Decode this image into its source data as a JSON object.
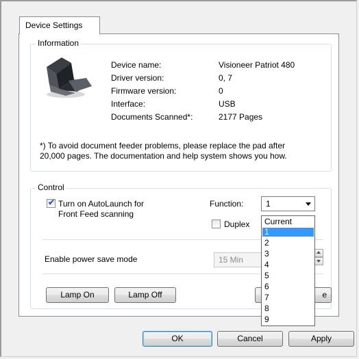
{
  "tab_label": "Device Settings",
  "information": {
    "group_label": "Information",
    "rows": [
      {
        "label": "Device name:",
        "value": "Visioneer Patriot 480"
      },
      {
        "label": "Driver version:",
        "value": "0, 7"
      },
      {
        "label": "Firmware version:",
        "value": "0"
      },
      {
        "label": "Interface:",
        "value": "USB"
      },
      {
        "label": "Documents Scanned*:",
        "value": "2177 Pages"
      }
    ],
    "note_line1": "*) To avoid document feeder problems, please replace the pad after",
    "note_line2": "20,000 pages. The documentation and help system shows you how.",
    "scanner_image": "document-scanner-image"
  },
  "control": {
    "group_label": "Control",
    "autolaunch_line1": "Turn on AutoLaunch for",
    "autolaunch_line2": "Front Feed scanning",
    "autolaunch_checked": true,
    "function_label": "Function:",
    "function_value": "1",
    "function_options": [
      "Current",
      "1",
      "2",
      "3",
      "4",
      "5",
      "6",
      "7",
      "8",
      "9"
    ],
    "function_selected": "1",
    "duplex_label": "Duplex",
    "duplex_checked": false,
    "power_save_label": "Enable power save mode",
    "power_save_value": "15 Min",
    "lamp_on_label": "Lamp On",
    "lamp_off_label": "Lamp Off",
    "partial_button_label": "e"
  },
  "buttons": {
    "ok": "OK",
    "cancel": "Cancel",
    "apply": "Apply"
  },
  "colors": {
    "selection": "#3399ff",
    "check": "#3a5ea8"
  }
}
